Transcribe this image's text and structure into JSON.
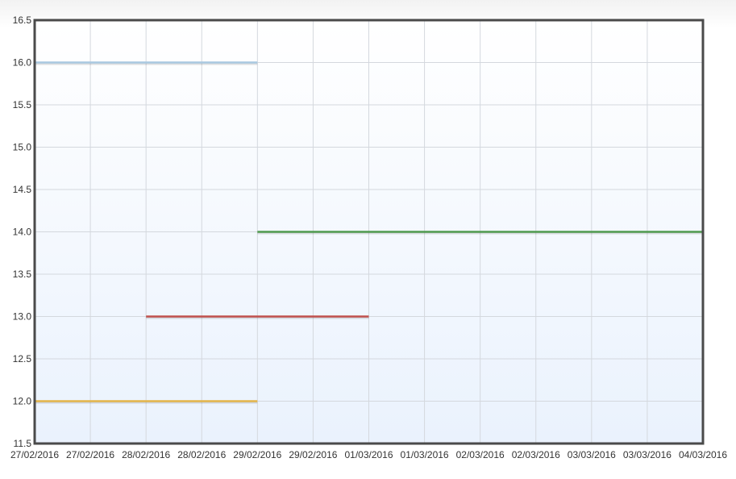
{
  "chart_data": {
    "type": "line",
    "title": "",
    "xlabel": "",
    "ylabel": "",
    "grid": true,
    "ylim": [
      11.5,
      16.5
    ],
    "y_ticks": [
      "11.5",
      "12.0",
      "12.5",
      "13.0",
      "13.5",
      "14.0",
      "14.5",
      "15.0",
      "15.5",
      "16.0",
      "16.5"
    ],
    "x_ticks": [
      "27/02/2016",
      "27/02/2016",
      "28/02/2016",
      "28/02/2016",
      "29/02/2016",
      "29/02/2016",
      "01/03/2016",
      "01/03/2016",
      "02/03/2016",
      "02/03/2016",
      "03/03/2016",
      "03/03/2016",
      "04/03/2016"
    ],
    "x_range": [
      "2016-02-27 00:00",
      "2016-03-04 00:00"
    ],
    "series": [
      {
        "color": "#a9c8e0",
        "points": [
          {
            "x": "2016-02-27 00:00",
            "y": 16.0
          },
          {
            "x": "2016-02-29 00:00",
            "y": 16.0
          }
        ]
      },
      {
        "color": "#4f9a4f",
        "points": [
          {
            "x": "2016-02-29 00:00",
            "y": 14.0
          },
          {
            "x": "2016-03-04 00:00",
            "y": 14.0
          }
        ]
      },
      {
        "color": "#c0504d",
        "points": [
          {
            "x": "2016-02-28 00:00",
            "y": 13.0
          },
          {
            "x": "2016-03-01 00:00",
            "y": 13.0
          }
        ]
      },
      {
        "color": "#e3b448",
        "points": [
          {
            "x": "2016-02-27 00:00",
            "y": 12.0
          },
          {
            "x": "2016-02-29 00:00",
            "y": 12.0
          }
        ]
      }
    ]
  }
}
